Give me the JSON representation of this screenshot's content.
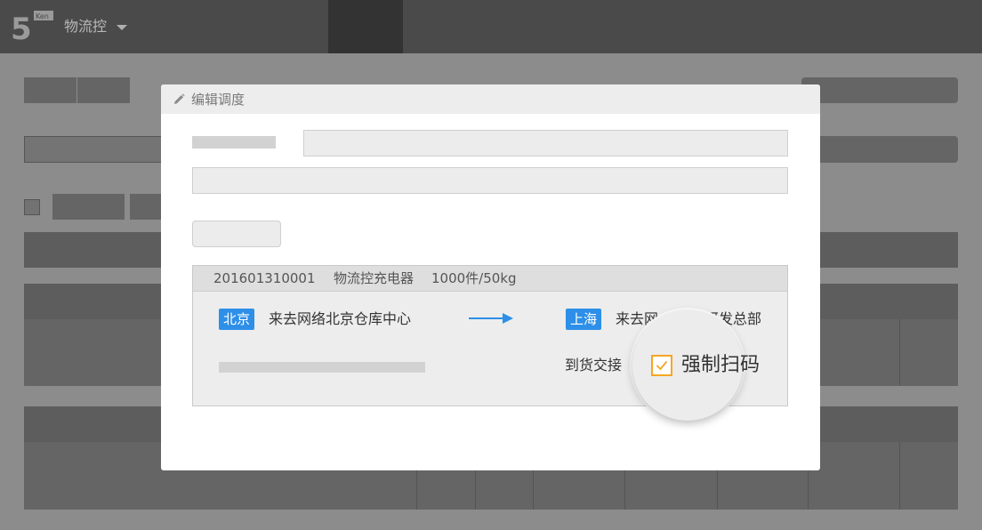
{
  "app": {
    "name": "物流控",
    "logo_badge": "Ken"
  },
  "modal": {
    "title": "编辑调度"
  },
  "order": {
    "id": "201601310001",
    "product": "物流控充电器",
    "quantity": "1000件/50kg",
    "from": {
      "city": "北京",
      "location": "来去网络北京仓库中心"
    },
    "to": {
      "city": "上海",
      "location_prefix": "来去网",
      "location_suffix": "研发总部"
    },
    "handover_label": "到货交接",
    "force_scan": {
      "label": "强制扫码",
      "checked": true
    }
  },
  "colors": {
    "tag_blue": "#2d8fe8",
    "checkbox_orange": "#f5a623",
    "topbar": "#4a4a4a"
  }
}
